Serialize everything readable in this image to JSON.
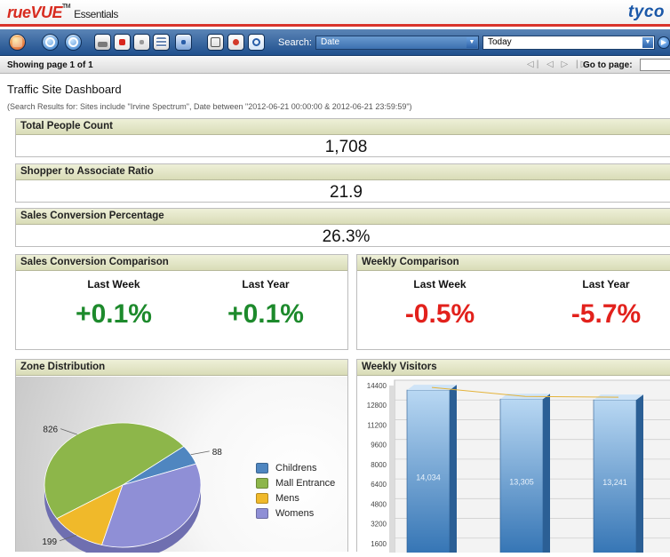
{
  "app": {
    "logo_text": "rueVUE",
    "logo_tm": "TM",
    "logo_suffix": "Essentials",
    "brand": "tyco"
  },
  "toolbar": {
    "icons": [
      "home-icon",
      "refresh-icon",
      "sync-icon",
      "print-icon",
      "pdf-icon",
      "document-icon",
      "grid-icon",
      "word-icon",
      "email-icon",
      "scheduled-report-icon",
      "search-icon"
    ],
    "search_label": "Search:",
    "search_field": "Date",
    "date_value": "Today"
  },
  "paging": {
    "showing": "Showing page  1  of  1",
    "controls": "◁| ◁ ▷ |▷",
    "goto_label": "Go to page:"
  },
  "page": {
    "title": "Traffic Site Dashboard",
    "subtitle": "(Search Results for: Sites include \"Irvine Spectrum\", Date between \"2012-06-21 00:00:00 & 2012-06-21 23:59:59\")"
  },
  "metrics": {
    "total_people": {
      "label": "Total People Count",
      "value": "1,708"
    },
    "shopper_ratio": {
      "label": "Shopper to Associate Ratio",
      "value": "21.9"
    },
    "sales_conversion": {
      "label": "Sales Conversion Percentage",
      "value": "26.3%"
    }
  },
  "sales_comparison": {
    "title": "Sales Conversion Comparison",
    "last_week_label": "Last Week",
    "last_week_value": "+0.1%",
    "last_year_label": "Last Year",
    "last_year_value": "+0.1%"
  },
  "weekly_comparison": {
    "title": "Weekly Comparison",
    "last_week_label": "Last Week",
    "last_week_value": "-0.5%",
    "last_year_label": "Last Year",
    "last_year_value": "-5.7%"
  },
  "colors": {
    "positive": "#1d8a2c",
    "negative": "#e2211c",
    "childrens": "#4f86c0",
    "mall_entrance": "#8db64a",
    "mens": "#f0b92a",
    "womens": "#8f8fd6"
  },
  "chart_data": [
    {
      "type": "pie",
      "title": "Zone Distribution",
      "categories": [
        "Childrens",
        "Mall Entrance",
        "Mens",
        "Womens"
      ],
      "values": [
        88,
        826,
        199,
        595
      ],
      "data_labels": [
        "88",
        "826",
        "199",
        ""
      ]
    },
    {
      "type": "bar",
      "title": "Weekly Visitors",
      "categories": [
        "",
        "",
        ""
      ],
      "values": [
        14034,
        13305,
        13241
      ],
      "data_labels": [
        "14,034",
        "13,305",
        "13,241"
      ],
      "yticks": [
        1600,
        3200,
        4800,
        6400,
        8000,
        9600,
        11200,
        12800,
        14400
      ],
      "ylim": [
        0,
        14400
      ],
      "grid": true
    }
  ]
}
